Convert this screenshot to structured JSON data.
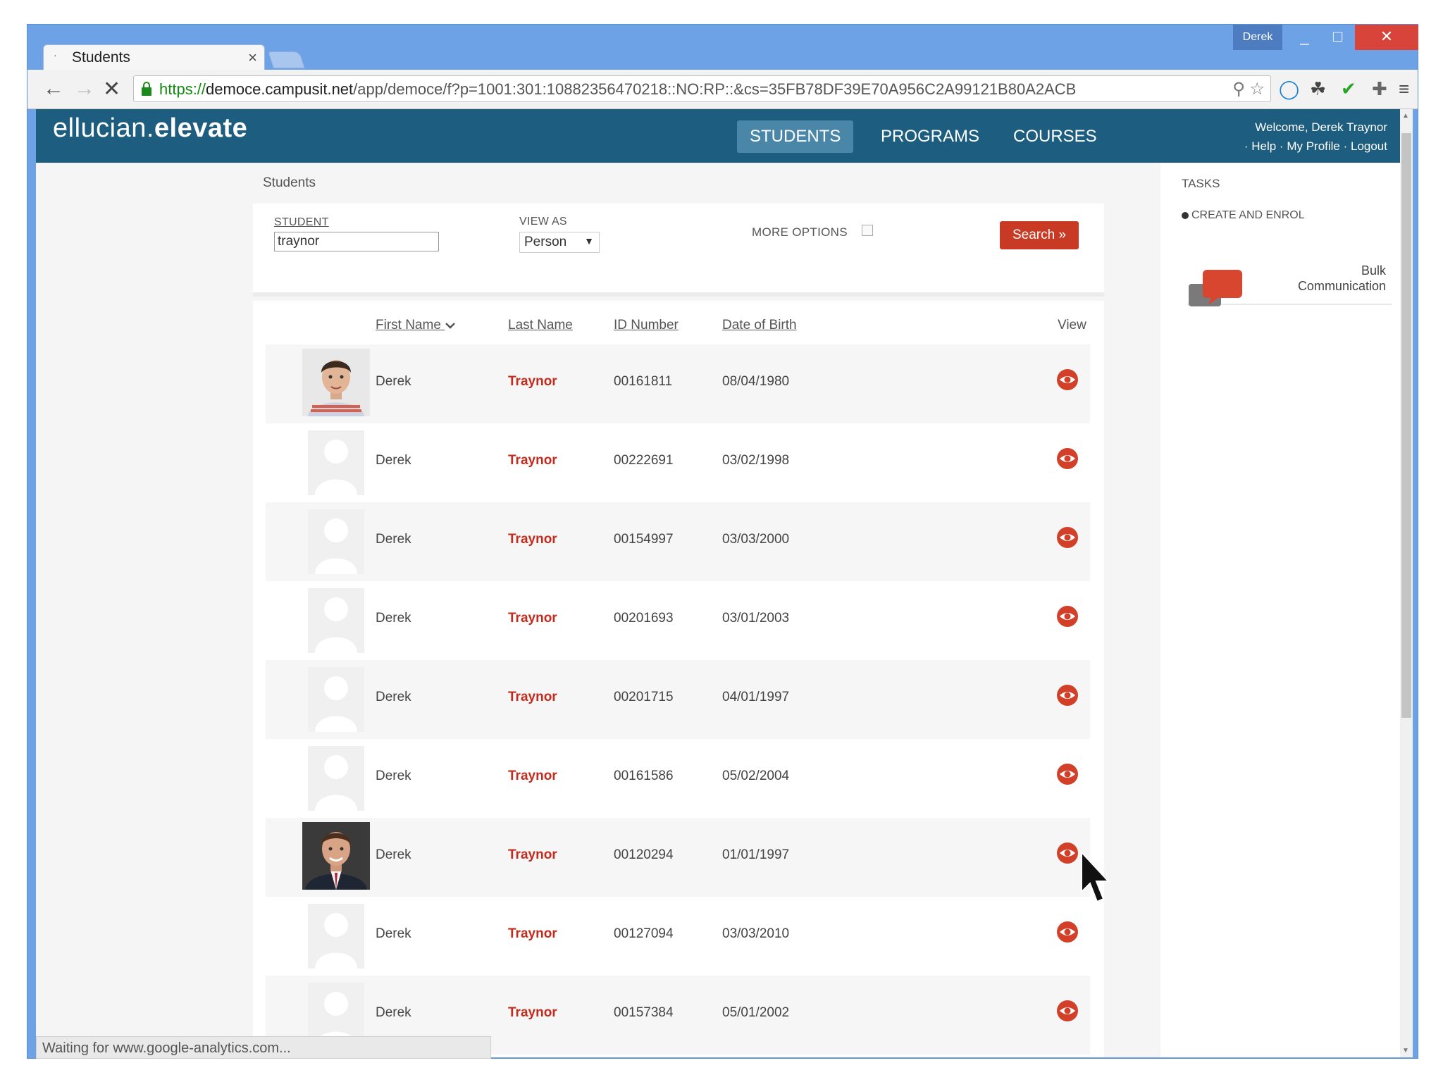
{
  "browser": {
    "tab_title": "Students",
    "tab_close": "×",
    "user_badge": "Derek",
    "min": "_",
    "max": "□",
    "close": "✕",
    "url_proto": "https://",
    "url_host": "democe.campusit.net",
    "url_path": "/app/democe/f?p=1001:301:10882356470218::NO:RP::&cs=35FB78DF39E70A956C2A99121B80A2ACB",
    "status": "Waiting for www.google-analytics.com..."
  },
  "header": {
    "logo_light": "ellucian.",
    "logo_bold": "elevate",
    "nav": [
      "STUDENTS",
      "PROGRAMS",
      "COURSES"
    ],
    "welcome": "Welcome, Derek Traynor",
    "links": "· Help · My Profile · Logout"
  },
  "page": {
    "breadcrumb": "Students"
  },
  "search": {
    "student_label": "STUDENT",
    "student_value": "traynor",
    "view_as_label": "VIEW AS",
    "view_as_value": "Person",
    "more_options_label": "MORE OPTIONS",
    "more_options_checked": false,
    "button": "Search »"
  },
  "table": {
    "headers": {
      "first_name": "First Name",
      "last_name": "Last Name",
      "id": "ID Number",
      "dob": "Date of Birth",
      "view": "View"
    },
    "rows": [
      {
        "first": "Derek",
        "last": "Traynor",
        "id": "00161811",
        "dob": "08/04/1980",
        "photo": "photo-young-man"
      },
      {
        "first": "Derek",
        "last": "Traynor",
        "id": "00222691",
        "dob": "03/02/1998",
        "photo": "placeholder"
      },
      {
        "first": "Derek",
        "last": "Traynor",
        "id": "00154997",
        "dob": "03/03/2000",
        "photo": "placeholder"
      },
      {
        "first": "Derek",
        "last": "Traynor",
        "id": "00201693",
        "dob": "03/01/2003",
        "photo": "placeholder"
      },
      {
        "first": "Derek",
        "last": "Traynor",
        "id": "00201715",
        "dob": "04/01/1997",
        "photo": "placeholder"
      },
      {
        "first": "Derek",
        "last": "Traynor",
        "id": "00161586",
        "dob": "05/02/2004",
        "photo": "placeholder"
      },
      {
        "first": "Derek",
        "last": "Traynor",
        "id": "00120294",
        "dob": "01/01/1997",
        "photo": "photo-man-suit"
      },
      {
        "first": "Derek",
        "last": "Traynor",
        "id": "00127094",
        "dob": "03/03/2010",
        "photo": "placeholder"
      },
      {
        "first": "Derek",
        "last": "Traynor",
        "id": "00157384",
        "dob": "05/01/2002",
        "photo": "placeholder"
      }
    ]
  },
  "tasks": {
    "heading": "TASKS",
    "items": [
      "CREATE AND ENROL"
    ],
    "bulk_line1": "Bulk",
    "bulk_line2": "Communication"
  },
  "colors": {
    "header_bg": "#1d5d7f",
    "accent_red": "#c42b1c",
    "nav_active": "#4a86a8"
  }
}
